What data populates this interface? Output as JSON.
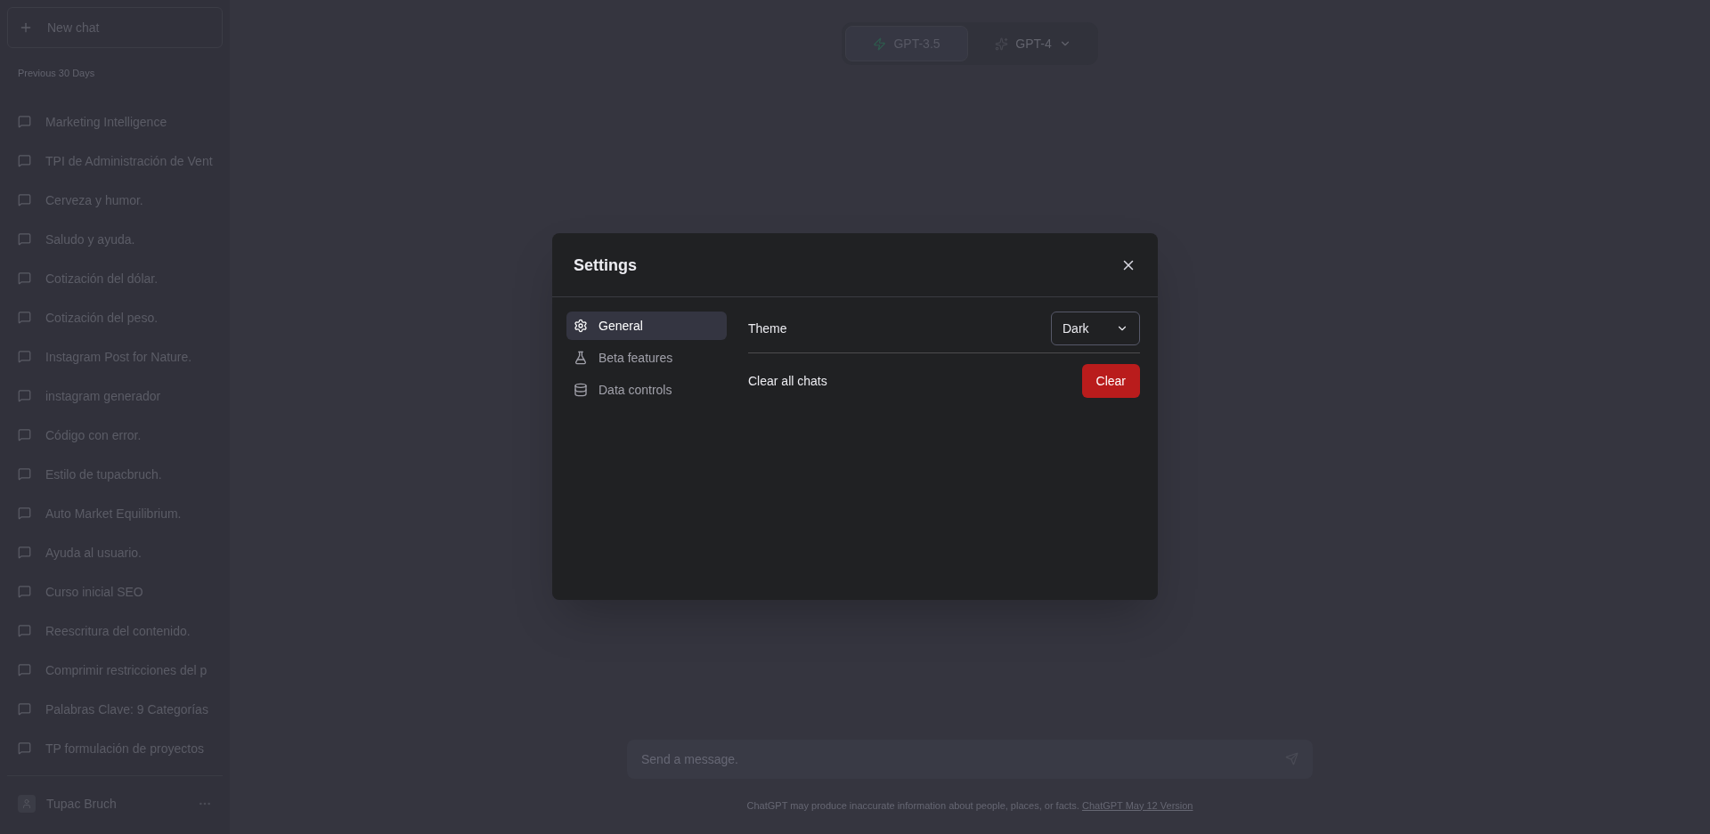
{
  "sidebar": {
    "new_chat": "New chat",
    "section": "Previous 30 Days",
    "chats": [
      "Marketing Intelligence",
      "TPI de Administración de Vent",
      "Cerveza y humor.",
      "Saludo y ayuda.",
      "Cotización del dólar.",
      "Cotización del peso.",
      "Instagram Post for Nature.",
      "instagram generador",
      "Código con error.",
      "Estilo de tupacbruch.",
      "Auto Market Equilibrium.",
      "Ayuda al usuario.",
      "Curso inicial SEO",
      "Reescritura del contenido.",
      "Comprimir restricciones del p",
      "Palabras Clave: 9 Categorías",
      "TP formulación de proyectos"
    ],
    "user": {
      "name": "Tupac Bruch"
    }
  },
  "model_selector": [
    {
      "label": "GPT-3.5",
      "kind": "bolt",
      "selected": true
    },
    {
      "label": "GPT-4",
      "kind": "sparkle",
      "selected": false
    }
  ],
  "composer": {
    "placeholder": "Send a message."
  },
  "footer": {
    "text": "ChatGPT may produce inaccurate information about people, places, or facts.",
    "link": "ChatGPT May 12 Version"
  },
  "settings": {
    "title": "Settings",
    "tabs": [
      {
        "label": "General",
        "kind": "gear",
        "selected": true
      },
      {
        "label": "Beta features",
        "kind": "flask",
        "selected": false
      },
      {
        "label": "Data controls",
        "kind": "database",
        "selected": false
      }
    ],
    "theme": {
      "label": "Theme",
      "value": "Dark"
    },
    "clear": {
      "label": "Clear all chats",
      "button": "Clear"
    }
  }
}
